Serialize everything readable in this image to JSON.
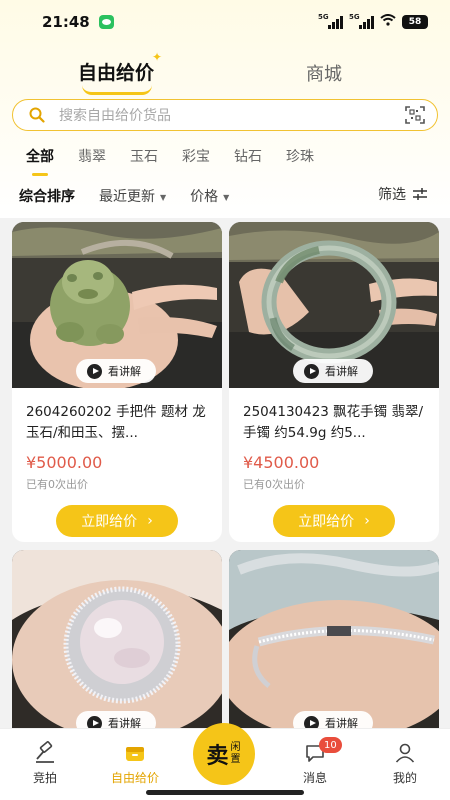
{
  "status": {
    "time": "21:48",
    "net1": "5G",
    "net2": "5G",
    "battery": "58"
  },
  "header": {
    "tab_active": "自由给价",
    "tab_other": "商城"
  },
  "search": {
    "placeholder": "搜索自由给价货品"
  },
  "categories": [
    "全部",
    "翡翠",
    "玉石",
    "彩宝",
    "钻石",
    "珍珠"
  ],
  "sort": {
    "comprehensive": "综合排序",
    "latest": "最近更新",
    "price": "价格",
    "filter": "筛选"
  },
  "products": [
    {
      "title": "2604260202 手把件 题材 龙 玉石/和田玉、摆...",
      "price": "¥5000.00",
      "bids": "已有0次出价",
      "talk": "看讲解",
      "button": "立即给价"
    },
    {
      "title": "2504130423 飘花手镯 翡翠/手镯 约54.9g 约5...",
      "price": "¥4500.00",
      "bids": "已有0次出价",
      "talk": "看讲解",
      "button": "立即给价"
    },
    {
      "talk": "看讲解"
    },
    {
      "talk": "看讲解"
    }
  ],
  "nav": {
    "auction": "竞拍",
    "free_bid": "自由给价",
    "sell_big": "卖",
    "sell_small": "闲置",
    "messages": "消息",
    "messages_badge": "10",
    "mine": "我的"
  },
  "colors": {
    "accent": "#f5c518",
    "price": "#e05b4a",
    "nav_active": "#e3a400"
  }
}
